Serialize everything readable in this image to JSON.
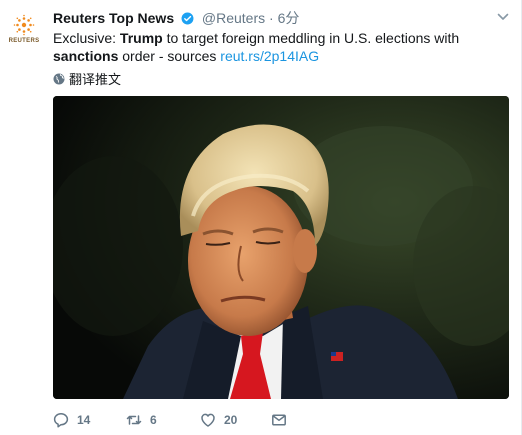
{
  "tweet": {
    "author_name": "Reuters Top News",
    "handle": "@Reuters",
    "separator": "·",
    "time": "6分",
    "avatar_text": "REUTERS",
    "text_parts": {
      "p1": "Exclusive: ",
      "p2": "Trump",
      "p3": " to target foreign meddling in U.S. elections with ",
      "p4": "sanctions",
      "p5": " order - sources ",
      "link": "reut.rs/2p14IAG"
    },
    "translate_label": "翻译推文",
    "photo_alt": "photo",
    "stats": {
      "replies": "14",
      "retweets": "6",
      "likes": "20"
    }
  },
  "icons": {
    "verified": "verified-badge-icon",
    "caret": "chevron-down-icon",
    "globe": "globe-icon",
    "reply": "reply-icon",
    "retweet": "retweet-icon",
    "like": "heart-icon",
    "dm": "envelope-icon"
  },
  "colors": {
    "link": "#1b95e0",
    "secondary": "#657786",
    "reuters_orange": "#ff8000"
  }
}
